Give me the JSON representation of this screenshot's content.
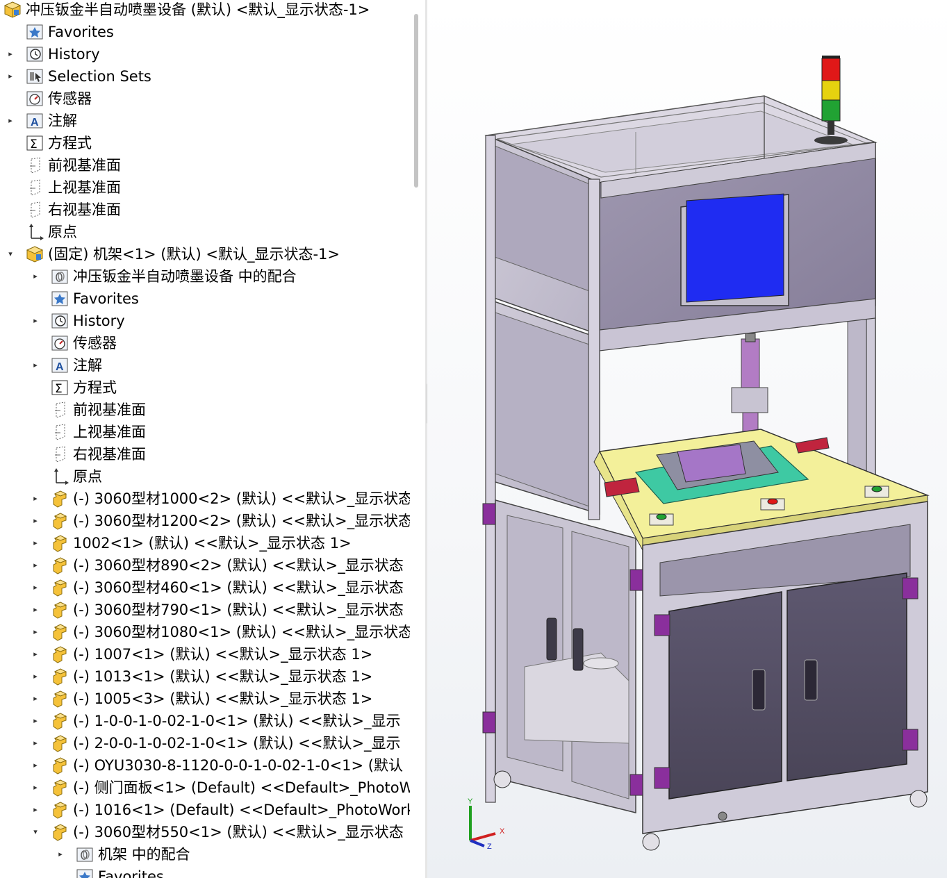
{
  "tree": {
    "root": {
      "label": "冲压钣金半自动喷墨设备 (默认) <默认_显示状态-1>"
    },
    "items": [
      {
        "label": "Favorites",
        "icon": "favorites-icon",
        "level": 1,
        "arrow": ""
      },
      {
        "label": "History",
        "icon": "history-icon",
        "level": 1,
        "arrow": "collapsed"
      },
      {
        "label": "Selection Sets",
        "icon": "selection-sets-icon",
        "level": 1,
        "arrow": "collapsed"
      },
      {
        "label": "传感器",
        "icon": "sensor-icon",
        "level": 1,
        "arrow": ""
      },
      {
        "label": "注解",
        "icon": "annotation-icon",
        "level": 1,
        "arrow": "collapsed"
      },
      {
        "label": "方程式",
        "icon": "equation-icon",
        "level": 1,
        "arrow": ""
      },
      {
        "label": "前视基准面",
        "icon": "plane-icon",
        "level": 1,
        "arrow": ""
      },
      {
        "label": "上视基准面",
        "icon": "plane-icon",
        "level": 1,
        "arrow": ""
      },
      {
        "label": "右视基准面",
        "icon": "plane-icon",
        "level": 1,
        "arrow": ""
      },
      {
        "label": "原点",
        "icon": "origin-icon",
        "level": 1,
        "arrow": ""
      },
      {
        "label": "(固定) 机架<1> (默认) <默认_显示状态-1>",
        "icon": "assembly-icon",
        "level": 1,
        "arrow": "expanded"
      },
      {
        "label": "冲压钣金半自动喷墨设备 中的配合",
        "icon": "mates-icon",
        "level": 2,
        "arrow": "collapsed"
      },
      {
        "label": "Favorites",
        "icon": "favorites-icon",
        "level": 2,
        "arrow": ""
      },
      {
        "label": "History",
        "icon": "history-icon",
        "level": 2,
        "arrow": "collapsed"
      },
      {
        "label": "传感器",
        "icon": "sensor-icon",
        "level": 2,
        "arrow": ""
      },
      {
        "label": "注解",
        "icon": "annotation-icon",
        "level": 2,
        "arrow": "collapsed"
      },
      {
        "label": "方程式",
        "icon": "equation-icon",
        "level": 2,
        "arrow": ""
      },
      {
        "label": "前视基准面",
        "icon": "plane-icon",
        "level": 2,
        "arrow": ""
      },
      {
        "label": "上视基准面",
        "icon": "plane-icon",
        "level": 2,
        "arrow": ""
      },
      {
        "label": "右视基准面",
        "icon": "plane-icon",
        "level": 2,
        "arrow": ""
      },
      {
        "label": "原点",
        "icon": "origin-icon",
        "level": 2,
        "arrow": ""
      },
      {
        "label": "(-) 3060型材1000<2> (默认) <<默认>_显示状态",
        "icon": "part-icon",
        "level": 2,
        "arrow": "collapsed"
      },
      {
        "label": "(-) 3060型材1200<2> (默认) <<默认>_显示状态",
        "icon": "part-icon",
        "level": 2,
        "arrow": "collapsed"
      },
      {
        "label": "1002<1> (默认) <<默认>_显示状态 1>",
        "icon": "part-icon",
        "level": 2,
        "arrow": "collapsed"
      },
      {
        "label": "(-) 3060型材890<2> (默认) <<默认>_显示状态",
        "icon": "part-icon",
        "level": 2,
        "arrow": "collapsed"
      },
      {
        "label": "(-) 3060型材460<1> (默认) <<默认>_显示状态",
        "icon": "part-icon",
        "level": 2,
        "arrow": "collapsed"
      },
      {
        "label": "(-) 3060型材790<1> (默认) <<默认>_显示状态",
        "icon": "part-icon",
        "level": 2,
        "arrow": "collapsed"
      },
      {
        "label": "(-) 3060型材1080<1> (默认) <<默认>_显示状态",
        "icon": "part-icon",
        "level": 2,
        "arrow": "collapsed"
      },
      {
        "label": "(-) 1007<1> (默认) <<默认>_显示状态 1>",
        "icon": "part-icon",
        "level": 2,
        "arrow": "collapsed"
      },
      {
        "label": "(-) 1013<1> (默认) <<默认>_显示状态 1>",
        "icon": "part-icon",
        "level": 2,
        "arrow": "collapsed"
      },
      {
        "label": "(-) 1005<3> (默认) <<默认>_显示状态 1>",
        "icon": "part-icon",
        "level": 2,
        "arrow": "collapsed"
      },
      {
        "label": "(-) 1-0-0-1-0-02-1-0<1> (默认) <<默认>_显示",
        "icon": "part-icon",
        "level": 2,
        "arrow": "collapsed"
      },
      {
        "label": "(-) 2-0-0-1-0-02-1-0<1> (默认) <<默认>_显示",
        "icon": "part-icon",
        "level": 2,
        "arrow": "collapsed"
      },
      {
        "label": "(-) OYU3030-8-1120-0-0-1-0-02-1-0<1> (默认",
        "icon": "part-icon",
        "level": 2,
        "arrow": "collapsed"
      },
      {
        "label": "(-) 侧门面板<1> (Default) <<Default>_PhotoW",
        "icon": "part-icon",
        "level": 2,
        "arrow": "collapsed"
      },
      {
        "label": "(-) 1016<1> (Default) <<Default>_PhotoWork",
        "icon": "part-icon",
        "level": 2,
        "arrow": "collapsed"
      },
      {
        "label": "(-) 3060型材550<1> (默认) <<默认>_显示状态",
        "icon": "part-icon",
        "level": 2,
        "arrow": "expanded"
      },
      {
        "label": "机架 中的配合",
        "icon": "mates-icon",
        "level": 3,
        "arrow": "collapsed"
      },
      {
        "label": "Favorites",
        "icon": "favorites-icon",
        "level": 3,
        "arrow": ""
      }
    ]
  },
  "triad": {
    "x": "X",
    "y": "Y",
    "z": "Z"
  },
  "colors": {
    "frame": "#b9b3c4",
    "panel": "#948ca6",
    "screen": "#1f2cf2",
    "table": "#f3f09a",
    "fixture": "#3ec9a3",
    "hinge": "#8a2f9c",
    "light_red": "#e01818",
    "light_yellow": "#e6d20f",
    "light_green": "#21a233"
  }
}
